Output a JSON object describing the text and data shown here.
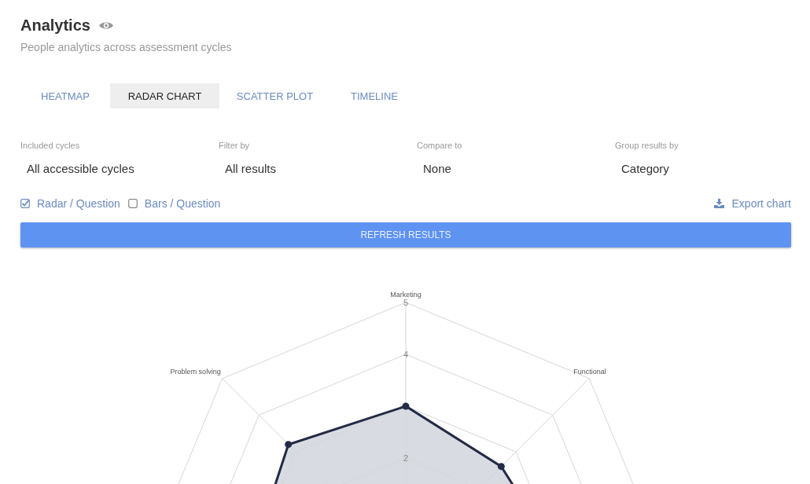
{
  "header": {
    "title": "Analytics",
    "subtitle": "People analytics across assessment cycles"
  },
  "tabs": [
    {
      "label": "HEATMAP",
      "selected": false
    },
    {
      "label": "RADAR CHART",
      "selected": true
    },
    {
      "label": "SCATTER PLOT",
      "selected": false
    },
    {
      "label": "TIMELINE",
      "selected": false
    }
  ],
  "filters": [
    {
      "label": "Included cycles",
      "value": "All accessible cycles"
    },
    {
      "label": "Filter by",
      "value": "All results"
    },
    {
      "label": "Compare to",
      "value": "None"
    },
    {
      "label": "Group results by",
      "value": "Category"
    }
  ],
  "options": [
    {
      "label": "Radar / Question",
      "checked": true
    },
    {
      "label": "Bars / Question",
      "checked": false
    }
  ],
  "export_label": "Export chart",
  "refresh_button": "REFRESH RESULTS",
  "radar": {
    "axis_labels": [
      "Marketing",
      "Functional",
      "Problem solving"
    ],
    "scale_labels": [
      "5",
      "4",
      "2"
    ]
  }
}
